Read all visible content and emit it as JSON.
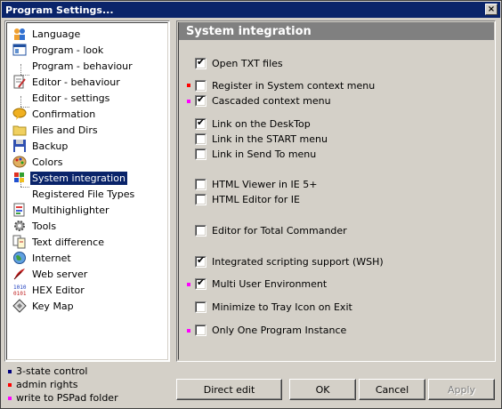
{
  "window": {
    "title": "Program Settings...",
    "close_label": "×"
  },
  "tree": {
    "items": [
      {
        "label": "Language",
        "icon": "people-icon"
      },
      {
        "label": "Program - look",
        "icon": "window-icon"
      },
      {
        "label": "Program - behaviour",
        "icon": ""
      },
      {
        "label": "Editor - behaviour",
        "icon": "edit-icon"
      },
      {
        "label": "Editor - settings",
        "icon": ""
      },
      {
        "label": "Confirmation",
        "icon": "speech-icon"
      },
      {
        "label": "Files and Dirs",
        "icon": "folder-icon"
      },
      {
        "label": "Backup",
        "icon": "disk-icon"
      },
      {
        "label": "Colors",
        "icon": "palette-icon"
      },
      {
        "label": "System integration",
        "icon": "windows-icon"
      },
      {
        "label": "Registered File Types",
        "icon": ""
      },
      {
        "label": "Multihighlighter",
        "icon": "highlight-icon"
      },
      {
        "label": "Tools",
        "icon": "gear-icon"
      },
      {
        "label": "Text difference",
        "icon": "diff-icon"
      },
      {
        "label": "Internet",
        "icon": "globe-icon"
      },
      {
        "label": "Web server",
        "icon": "feather-icon"
      },
      {
        "label": "HEX Editor",
        "icon": "hex-icon"
      },
      {
        "label": "Key Map",
        "icon": "key-icon"
      }
    ],
    "selected": "System integration"
  },
  "legend": [
    {
      "label": "3-state control",
      "color": "#000080"
    },
    {
      "label": "admin rights",
      "color": "#ff0000"
    },
    {
      "label": "write to PSPad folder",
      "color": "#ff00ff"
    }
  ],
  "panel": {
    "title": "System integration",
    "options": [
      {
        "label": "Open TXT files",
        "checked": true,
        "marker": ""
      },
      {
        "label": "Register in System context menu",
        "checked": false,
        "marker": "#ff0000"
      },
      {
        "label": "Cascaded context menu",
        "checked": true,
        "marker": "#ff00ff"
      },
      {
        "label": "Link on the DeskTop",
        "checked": true,
        "marker": ""
      },
      {
        "label": "Link in the START menu",
        "checked": false,
        "marker": ""
      },
      {
        "label": "Link in Send To menu",
        "checked": false,
        "marker": ""
      },
      {
        "label": "HTML Viewer in IE 5+",
        "checked": false,
        "marker": ""
      },
      {
        "label": "HTML Editor for IE",
        "checked": false,
        "marker": ""
      },
      {
        "label": "Editor for Total Commander",
        "checked": false,
        "marker": ""
      },
      {
        "label": "Integrated scripting support (WSH)",
        "checked": true,
        "marker": ""
      },
      {
        "label": "Multi User Environment",
        "checked": true,
        "marker": "#ff00ff"
      },
      {
        "label": "Minimize to Tray Icon on Exit",
        "checked": false,
        "marker": ""
      },
      {
        "label": "Only One Program Instance",
        "checked": false,
        "marker": "#ff00ff"
      }
    ]
  },
  "buttons": {
    "direct_edit": "Direct edit",
    "ok": "OK",
    "cancel": "Cancel",
    "apply": "Apply"
  }
}
